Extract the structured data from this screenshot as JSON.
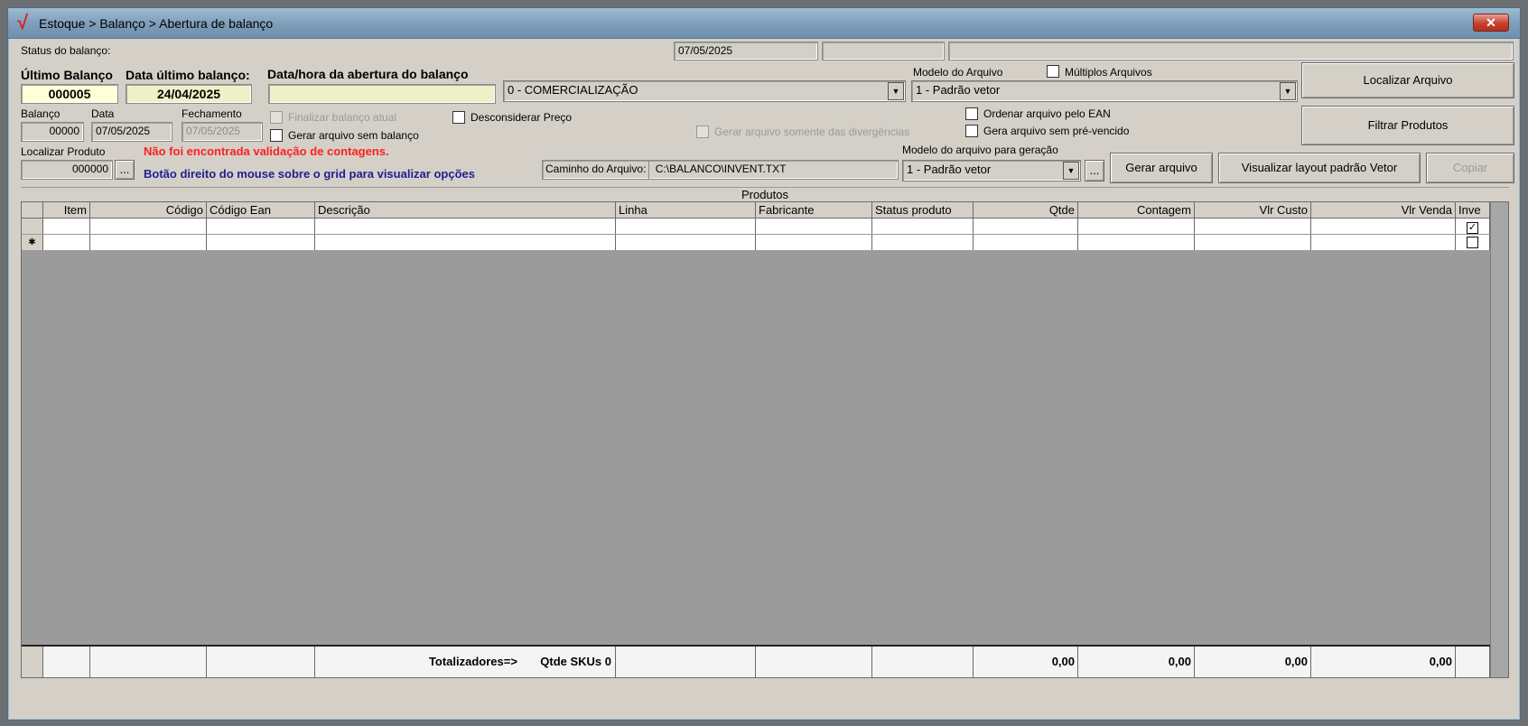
{
  "window": {
    "logo": "√",
    "title": "Estoque > Balanço > Abertura de balanço",
    "close": "✕"
  },
  "status": {
    "label": "Status do balanço:",
    "date": "07/05/2025"
  },
  "ultimo": {
    "label": "Último Balanço",
    "value": "000005",
    "data_label": "Data último balanço:",
    "data_value": "24/04/2025",
    "abertura_label": "Data/hora da abertura do balanço"
  },
  "tipo_combo": "0 - COMERCIALIZAÇÃO",
  "modelo": {
    "label": "Modelo do Arquivo",
    "value": "1 - Padrão vetor",
    "multiplos": "Múltiplos Arquivos"
  },
  "buttons": {
    "localizar": "Localizar Arquivo",
    "filtrar": "Filtrar Produtos",
    "gerar": "Gerar arquivo",
    "visualizar": "Visualizar layout padrão Vetor",
    "copiar": "Copiar",
    "ellipsis": "..."
  },
  "balanco": {
    "label": "Balanço",
    "value": "00000",
    "data_label": "Data",
    "data_value": "07/05/2025",
    "fech_label": "Fechamento",
    "fech_value": "07/05/2025"
  },
  "checks": {
    "finalizar": "Finalizar balanço atual",
    "sem_balanco": "Gerar arquivo sem balanço",
    "desconsiderar": "Desconsiderar Preço",
    "divergencias": "Gerar arquivo somente das divergências",
    "ordenar_ean": "Ordenar arquivo pelo EAN",
    "pre_vencido": "Gera arquivo sem pré-vencido"
  },
  "localizar_produto": {
    "label": "Localizar Produto",
    "value": "000000"
  },
  "messages": {
    "error": "Não foi encontrada validação de contagens.",
    "hint": "Botão direito do mouse sobre o grid para visualizar opções"
  },
  "caminho": {
    "label": "Caminho do Arquivo:",
    "value": "C:\\BALANCO\\INVENT.TXT"
  },
  "modelo_geracao": {
    "label": "Modelo do arquivo para geração",
    "value": "1 - Padrão vetor"
  },
  "grid": {
    "title": "Produtos",
    "columns": [
      "Item",
      "Código",
      "Código Ean",
      "Descrição",
      "Linha",
      "Fabricante",
      "Status produto",
      "Qtde",
      "Contagem",
      "Vlr Custo",
      "Vlr Venda",
      "Inve"
    ],
    "new_row_marker": "✱",
    "check_mark": "✓",
    "totals": {
      "label": "Totalizadores=>",
      "skus": "Qtde SKUs 0",
      "qtde": "0,00",
      "contagem": "0,00",
      "vlr_custo": "0,00",
      "vlr_venda": "0,00"
    }
  }
}
